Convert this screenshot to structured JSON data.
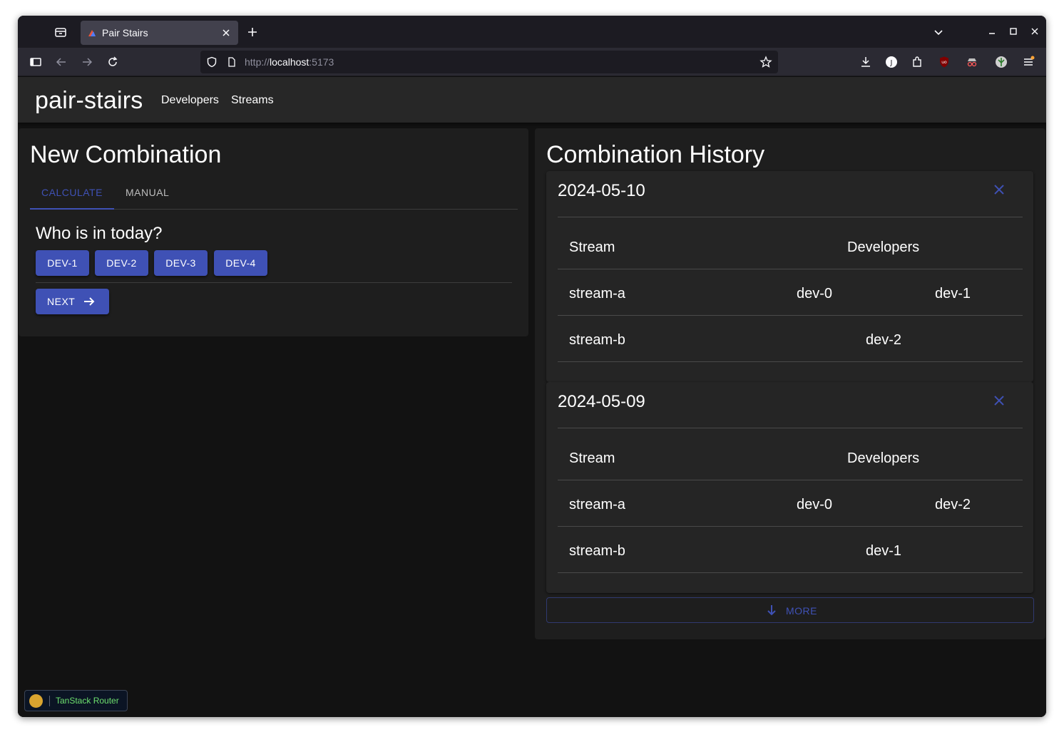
{
  "browser": {
    "tab_title": "Pair Stairs",
    "url_scheme": "http://",
    "url_host": "localhost",
    "url_port": ":5173"
  },
  "app": {
    "brand": "pair-stairs",
    "nav": {
      "developers": "Developers",
      "streams": "Streams"
    }
  },
  "new_combination": {
    "title": "New Combination",
    "tabs": {
      "calculate": "CALCULATE",
      "manual": "MANUAL",
      "active": "calculate"
    },
    "question": "Who is in today?",
    "developers": [
      "DEV-1",
      "DEV-2",
      "DEV-3",
      "DEV-4"
    ],
    "next_label": "NEXT"
  },
  "history": {
    "title": "Combination History",
    "header_stream": "Stream",
    "header_developers": "Developers",
    "cards": [
      {
        "date": "2024-05-10",
        "rows": [
          {
            "stream": "stream-a",
            "developers": [
              "dev-0",
              "dev-1"
            ]
          },
          {
            "stream": "stream-b",
            "developers": [
              "dev-2"
            ]
          }
        ]
      },
      {
        "date": "2024-05-09",
        "rows": [
          {
            "stream": "stream-a",
            "developers": [
              "dev-0",
              "dev-2"
            ]
          },
          {
            "stream": "stream-b",
            "developers": [
              "dev-1"
            ]
          }
        ]
      }
    ],
    "more_label": "MORE"
  },
  "devtools": {
    "label": "TanStack Router"
  },
  "colors": {
    "primary": "#3f51b5",
    "surface": "#1e1e1e",
    "background": "#121212"
  }
}
